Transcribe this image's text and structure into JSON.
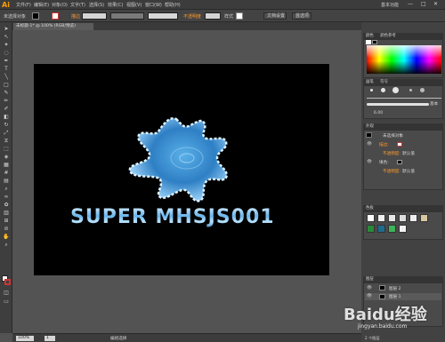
{
  "app": {
    "logo": "Ai",
    "menu": [
      "文件(F)",
      "编辑(E)",
      "对象(O)",
      "文字(T)",
      "选择(S)",
      "效果(C)",
      "视图(V)",
      "窗口(W)",
      "帮助(H)"
    ],
    "workspace": "基本功能",
    "window_controls": [
      "—",
      "□",
      "✕"
    ]
  },
  "control_bar": {
    "selection": "未选择对象",
    "stroke_label": "描边",
    "opacity_label": "不透明度",
    "style_label": "样式",
    "doc_setup": "文档设置",
    "prefs": "首选项"
  },
  "document": {
    "tab_title": "未标题-1* @ 100% (RGB/预览)"
  },
  "artwork": {
    "text": "SUPER MHSJS001"
  },
  "status": {
    "zoom": "100%",
    "page": "1",
    "tool": "编组选择"
  },
  "panels": {
    "color_title": "颜色",
    "color_guide_title": "颜色参考",
    "brush_title": "画笔",
    "brush_tabs": [
      "画笔",
      "符号"
    ],
    "stroke_weight": "6.00",
    "brush_name": "基本",
    "appearance_title": "外观",
    "appearance_object": "未选择对象",
    "appearance_rows": [
      {
        "label": "描边:",
        "value": ""
      },
      {
        "label": "不透明度:",
        "value": "默认值"
      },
      {
        "label": "填色:",
        "value": ""
      },
      {
        "label": "不透明度:",
        "value": "默认值"
      }
    ],
    "swatches_title": "色板",
    "layers_title": "图层",
    "layers": [
      {
        "name": "图层 2"
      },
      {
        "name": "图层 1"
      }
    ],
    "layers_count": "2 个图层"
  },
  "watermark": {
    "brand": "Baidu经验",
    "url": "jingyan.baidu.com"
  }
}
